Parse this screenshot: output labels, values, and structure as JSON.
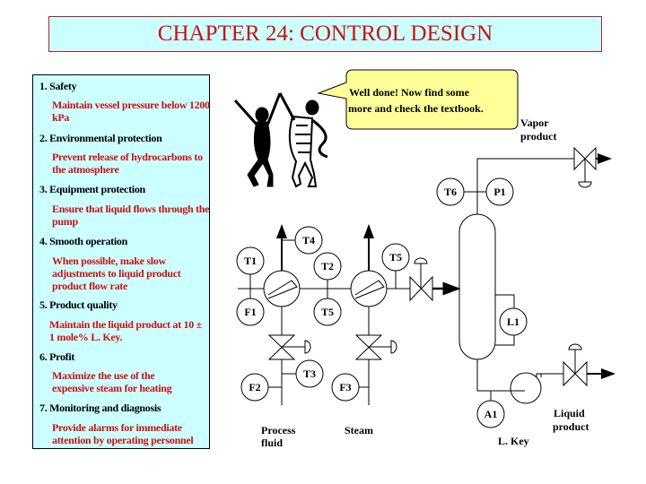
{
  "title": "CHAPTER 24: CONTROL DESIGN",
  "objectives": [
    {
      "label": "1.  Safety",
      "detail": "Maintain vessel pressure below 1200 kPa"
    },
    {
      "label": "2.  Environmental protection",
      "detail": "Prevent release of hydrocarbons to the atmosphere"
    },
    {
      "label": "3.  Equipment protection",
      "detail": "Ensure that liquid flows through the pump"
    },
    {
      "label": "4.  Smooth operation",
      "detail": "When possible, make slow adjustments to liquid product product flow rate"
    },
    {
      "label": "5.  Product quality",
      "detail": "Maintain the liquid product at 10 ± 1 mole% L. Key."
    },
    {
      "label": "6.  Profit",
      "detail": "Maximize the use of the expensive steam for heating"
    },
    {
      "label": "7.  Monitoring and diagnosis",
      "detail": "Provide alarms for immediate attention by operating personnel"
    }
  ],
  "callout": {
    "line1": "Well done!  Now find some",
    "line2": "more and check the textbook.",
    "fill": "#ffff99"
  },
  "instruments": {
    "T1": "T1",
    "F1": "F1",
    "T2": "T2",
    "T5a": "T5",
    "T4": "T4",
    "T5b": "T5",
    "T3": "T3",
    "F2": "F2",
    "F3": "F3",
    "T6": "T6",
    "P1": "P1",
    "L1": "L1",
    "A1": "A1"
  },
  "streams": {
    "vapor": [
      "Vapor",
      "product"
    ],
    "liquid": [
      "Liquid",
      "product"
    ],
    "process": [
      "Process",
      "fluid"
    ],
    "steam": "Steam",
    "lkey": "L. Key"
  },
  "colors": {
    "title_text": "#cc1111",
    "panel": "#ccffff",
    "detail_text": "#cc1111"
  }
}
